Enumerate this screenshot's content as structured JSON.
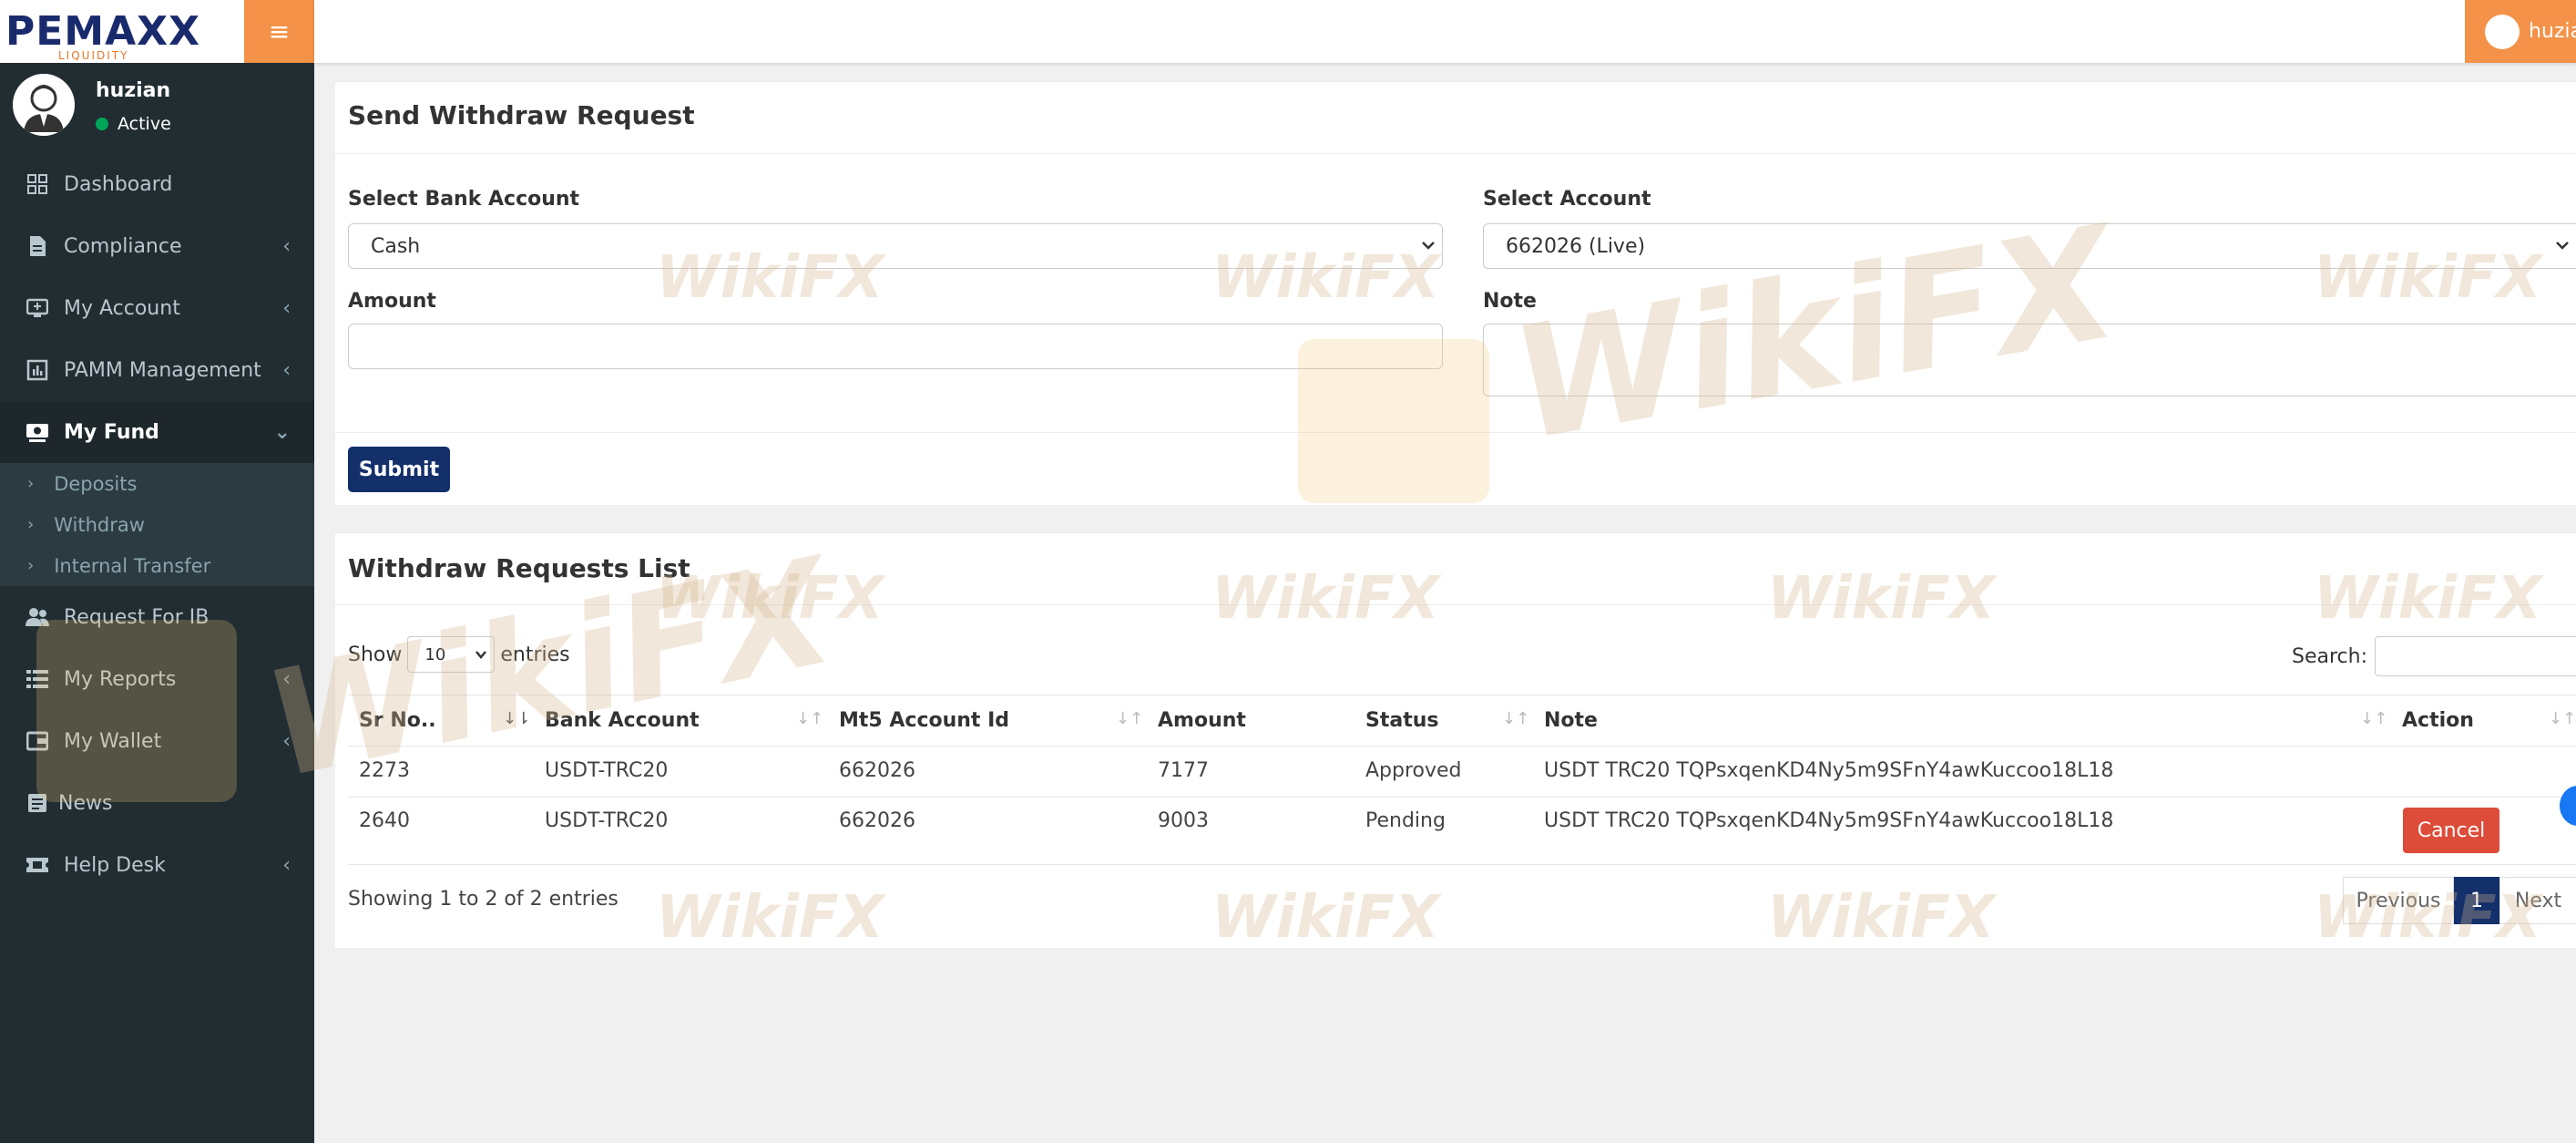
{
  "brand": {
    "name": "PEMAXX",
    "sub": "LIQUIDITY",
    "accent": "#f39248",
    "primary": "#13306b"
  },
  "user": {
    "name": "huzian",
    "status": "Active",
    "top_name": "huzia"
  },
  "sidebar": {
    "items": [
      {
        "label": "Dashboard",
        "icon": "dashboard-icon",
        "chevron": ""
      },
      {
        "label": "Compliance",
        "icon": "document-icon",
        "chevron": "‹"
      },
      {
        "label": "My Account",
        "icon": "monitor-icon",
        "chevron": "‹"
      },
      {
        "label": "PAMM Management",
        "icon": "chart-icon",
        "chevron": "‹"
      },
      {
        "label": "My Fund",
        "icon": "fund-icon",
        "chevron": "⌄"
      },
      {
        "label": "Request For IB",
        "icon": "users-icon",
        "chevron": ""
      },
      {
        "label": "My Reports",
        "icon": "list-icon",
        "chevron": "‹"
      },
      {
        "label": "My Wallet",
        "icon": "wallet-icon",
        "chevron": "‹"
      },
      {
        "label": "News",
        "icon": "news-icon",
        "chevron": ""
      },
      {
        "label": "Help Desk",
        "icon": "ticket-icon",
        "chevron": "‹"
      }
    ],
    "submenu": [
      "Deposits",
      "Withdraw",
      "Internal Transfer"
    ]
  },
  "form": {
    "title": "Send Withdraw Request",
    "bank_label": "Select Bank Account",
    "bank_value": "Cash",
    "account_label": "Select Account",
    "account_value": "662026 (Live)",
    "amount_label": "Amount",
    "note_label": "Note",
    "submit": "Submit"
  },
  "list": {
    "title": "Withdraw Requests List",
    "show": "Show",
    "entries": "entries",
    "length_value": "10",
    "search_label": "Search:",
    "columns": [
      "Sr No..",
      "Bank Account",
      "Mt5 Account Id",
      "Amount",
      "Status",
      "Note",
      "Action"
    ],
    "rows": [
      {
        "sr": "2273",
        "bank": "USDT-TRC20",
        "account": "662026",
        "amount": "7177",
        "status": "Approved",
        "note": "USDT TRC20 TQPsxqenKD4Ny5m9SFnY4awKuccoo18L18",
        "action": ""
      },
      {
        "sr": "2640",
        "bank": "USDT-TRC20",
        "account": "662026",
        "amount": "9003",
        "status": "Pending",
        "note": "USDT TRC20 TQPsxqenKD4Ny5m9SFnY4awKuccoo18L18",
        "action": "Cancel"
      }
    ],
    "info": "Showing 1 to 2 of 2 entries",
    "pagination": {
      "prev": "Previous",
      "page": "1",
      "next": "Next"
    }
  },
  "watermark": "WikiFX"
}
